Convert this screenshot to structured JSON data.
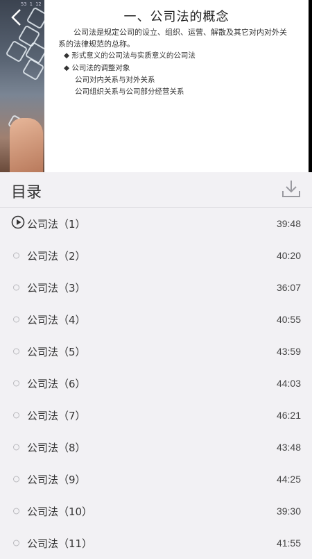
{
  "slide": {
    "tiny_text": "53 1 12",
    "title": "一、公司法的概念",
    "paragraph_line1": "公司法是规定公司的设立、组织、运营、解散及其它对内对外关",
    "paragraph_line2": "系的法律规范的总称。",
    "bullet1": "◆ 形式意义的公司法与实质意义的公司法",
    "bullet2": "◆ 公司法的调整对象",
    "sub1": "公司对内关系与对外关系",
    "sub2": "公司组织关系与公司部分经营关系"
  },
  "header": {
    "title": "目录"
  },
  "episodes": [
    {
      "name": "公司法（1）",
      "duration": "39:48",
      "state": "playing"
    },
    {
      "name": "公司法（2）",
      "duration": "40:20",
      "state": "idle"
    },
    {
      "name": "公司法（3）",
      "duration": "36:07",
      "state": "idle"
    },
    {
      "name": "公司法（4）",
      "duration": "40:55",
      "state": "idle"
    },
    {
      "name": "公司法（5）",
      "duration": "43:59",
      "state": "idle"
    },
    {
      "name": "公司法（6）",
      "duration": "44:03",
      "state": "idle"
    },
    {
      "name": "公司法（7）",
      "duration": "46:21",
      "state": "idle"
    },
    {
      "name": "公司法（8）",
      "duration": "43:48",
      "state": "idle"
    },
    {
      "name": "公司法（9）",
      "duration": "44:25",
      "state": "idle"
    },
    {
      "name": "公司法（10）",
      "duration": "39:30",
      "state": "idle"
    },
    {
      "name": "公司法（11）",
      "duration": "41:55",
      "state": "idle"
    }
  ],
  "icons": {
    "back": "chevron-left-icon",
    "download": "download-icon",
    "playing": "play-circle-icon",
    "idle": "circle-icon"
  },
  "colors": {
    "background": "#f2f1f4",
    "text": "#333333",
    "divider": "#dcdbe0"
  }
}
